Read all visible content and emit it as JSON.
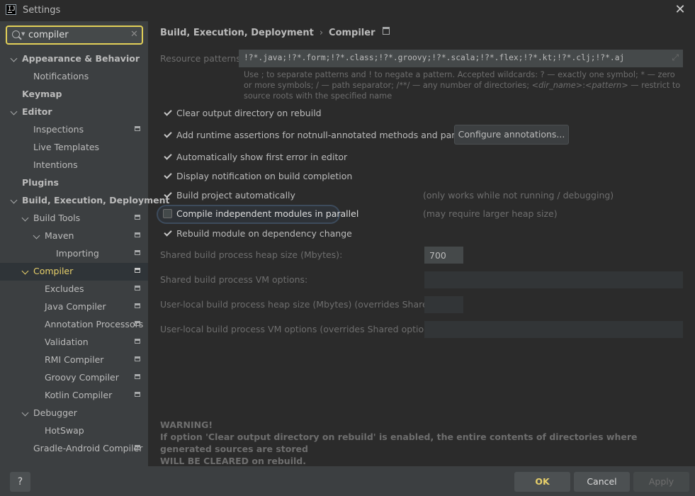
{
  "window": {
    "title": "Settings",
    "app_icon": "intellij-icon",
    "close_icon": "close-icon"
  },
  "search": {
    "value": "compiler",
    "icon": "search-icon",
    "clear_icon": "clear-icon"
  },
  "tree": [
    {
      "label": "Appearance & Behavior",
      "bold": true,
      "expandable": true,
      "icon": false
    },
    {
      "label": "Notifications",
      "bold": false,
      "expandable": false,
      "icon": false
    },
    {
      "label": "Keymap",
      "bold": true,
      "expandable": false,
      "icon": false
    },
    {
      "label": "Editor",
      "bold": true,
      "expandable": true,
      "icon": false
    },
    {
      "label": "Inspections",
      "bold": false,
      "expandable": false,
      "icon": true
    },
    {
      "label": "Live Templates",
      "bold": false,
      "expandable": false,
      "icon": false
    },
    {
      "label": "Intentions",
      "bold": false,
      "expandable": false,
      "icon": false
    },
    {
      "label": "Plugins",
      "bold": true,
      "expandable": false,
      "icon": false
    },
    {
      "label": "Build, Execution, Deployment",
      "bold": true,
      "expandable": true,
      "icon": false
    },
    {
      "label": "Build Tools",
      "bold": false,
      "expandable": true,
      "icon": true
    },
    {
      "label": "Maven",
      "bold": false,
      "expandable": true,
      "icon": true
    },
    {
      "label": "Importing",
      "bold": false,
      "expandable": false,
      "icon": true
    },
    {
      "label": "Compiler",
      "bold": false,
      "expandable": true,
      "icon": true,
      "selected": true
    },
    {
      "label": "Excludes",
      "bold": false,
      "expandable": false,
      "icon": true
    },
    {
      "label": "Java Compiler",
      "bold": false,
      "expandable": false,
      "icon": true
    },
    {
      "label": "Annotation Processors",
      "bold": false,
      "expandable": false,
      "icon": true
    },
    {
      "label": "Validation",
      "bold": false,
      "expandable": false,
      "icon": true
    },
    {
      "label": "RMI Compiler",
      "bold": false,
      "expandable": false,
      "icon": true
    },
    {
      "label": "Groovy Compiler",
      "bold": false,
      "expandable": false,
      "icon": true
    },
    {
      "label": "Kotlin Compiler",
      "bold": false,
      "expandable": false,
      "icon": true
    },
    {
      "label": "Debugger",
      "bold": false,
      "expandable": true,
      "icon": false
    },
    {
      "label": "HotSwap",
      "bold": false,
      "expandable": false,
      "icon": false
    },
    {
      "label": "Gradle-Android Compiler",
      "bold": false,
      "expandable": false,
      "icon": true
    }
  ],
  "breadcrumb": {
    "parent": "Build, Execution, Deployment",
    "separator": "›",
    "current": "Compiler",
    "icon": "project-scope-icon"
  },
  "resource_patterns": {
    "label": "Resource patterns:",
    "value": "!?*.java;!?*.form;!?*.class;!?*.groovy;!?*.scala;!?*.flex;!?*.kt;!?*.clj;!?*.aj",
    "expand_icon": "expand-icon"
  },
  "help_text": {
    "p1": "Use ; to separate patterns and ! to negate a pattern. Accepted wildcards: ? — exactly one symbol; * — zero or more symbols; / — path separator; /**/ — any number of directories; ",
    "dir_name": "<dir_name>",
    "colon": ":",
    "pattern": "<pattern>",
    "p2": " — restrict to source roots with the specified name"
  },
  "checkboxes": {
    "clear_output": {
      "label": "Clear output directory on rebuild",
      "checked": true
    },
    "runtime_assertions": {
      "label": "Add runtime assertions for notnull-annotated methods and parameters",
      "checked": true
    },
    "show_first_error": {
      "label": "Automatically show first error in editor",
      "checked": true
    },
    "notify_build": {
      "label": "Display notification on build completion",
      "checked": true
    },
    "build_auto": {
      "label": "Build project automatically",
      "checked": true,
      "note": "(only works while not running / debugging)"
    },
    "parallel": {
      "label": "Compile independent modules in parallel",
      "checked": false,
      "note": "(may require larger heap size)"
    },
    "rebuild_dep": {
      "label": "Rebuild module on dependency change",
      "checked": true
    }
  },
  "configure_button": "Configure annotations...",
  "fields": {
    "shared_heap": {
      "label": "Shared build process heap size (Mbytes):",
      "value": "700"
    },
    "shared_vm": {
      "label": "Shared build process VM options:",
      "value": ""
    },
    "local_heap": {
      "label": "User-local build process heap size (Mbytes) (overrides Shared size):",
      "value": ""
    },
    "local_vm": {
      "label": "User-local build process VM options (overrides Shared options):",
      "value": ""
    }
  },
  "warning": {
    "title": "WARNING!",
    "line1": "If option 'Clear output directory on rebuild' is enabled, the entire contents of directories where generated sources are stored",
    "line2": "WILL BE CLEARED on rebuild."
  },
  "footer": {
    "help": "?",
    "ok": "OK",
    "cancel": "Cancel",
    "apply": "Apply"
  },
  "colors": {
    "accent_yellow": "#e2d058",
    "selected_text": "#e8d06a",
    "background": "#2b2b2b",
    "sidebar": "#3c3f41"
  }
}
